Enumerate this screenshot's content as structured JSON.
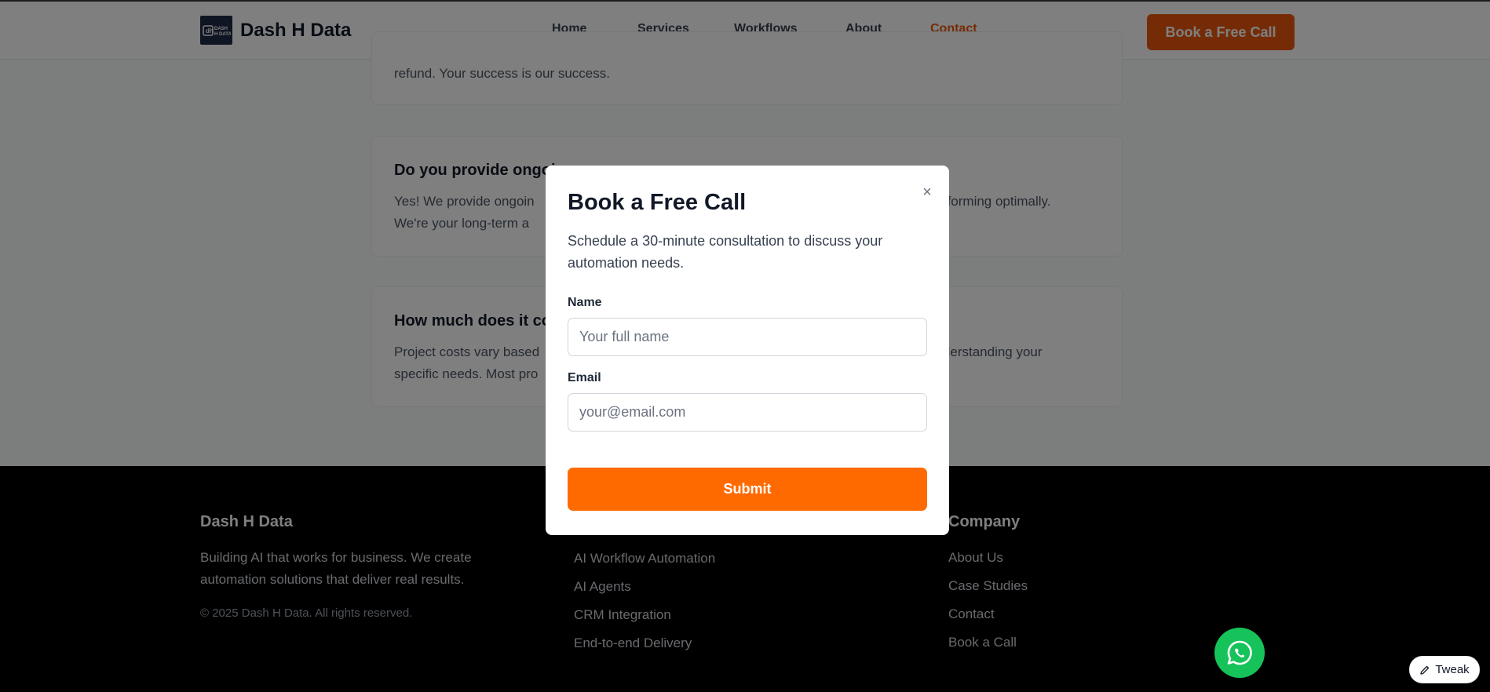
{
  "header": {
    "brand_name": "Dash H Data",
    "logo_text": "DASH H DATA",
    "nav": [
      "Home",
      "Services",
      "Workflows",
      "About",
      "Contact"
    ],
    "active_nav": "Contact",
    "cta_label": "Book a Free Call"
  },
  "faq": [
    {
      "question": "",
      "answer": "refund. Your success is our success."
    },
    {
      "question": "Do you provide ongoin",
      "answer": "Yes! We provide ongoin",
      "answer_tail": "performing optimally.",
      "answer2": "We're your long-term a"
    },
    {
      "question": "How much does it co",
      "answer": "Project costs vary based",
      "answer_tail": "understanding your",
      "answer2": "specific needs. Most pro"
    }
  ],
  "footer": {
    "col1": {
      "title": "Dash H Data",
      "description": "Building AI that works for business. We create automation solutions that deliver real results.",
      "copyright": "© 2025 Dash H Data. All rights reserved."
    },
    "col2": {
      "links": [
        "AI Workflow Automation",
        "AI Agents",
        "CRM Integration",
        "End-to-end Delivery"
      ]
    },
    "col3": {
      "title": "Company",
      "links": [
        "About Us",
        "Case Studies",
        "Contact",
        "Book a Call"
      ]
    }
  },
  "modal": {
    "title": "Book a Free Call",
    "close_glyph": "×",
    "description": "Schedule a 30-minute consultation to discuss your automation needs.",
    "name_label": "Name",
    "name_placeholder": "Your full name",
    "email_label": "Email",
    "email_placeholder": "your@email.com",
    "submit_label": "Submit"
  },
  "tweak_label": "Tweak",
  "colors": {
    "accent": "#ea580c",
    "submit": "#ff6a00",
    "whatsapp": "#16c35a"
  }
}
